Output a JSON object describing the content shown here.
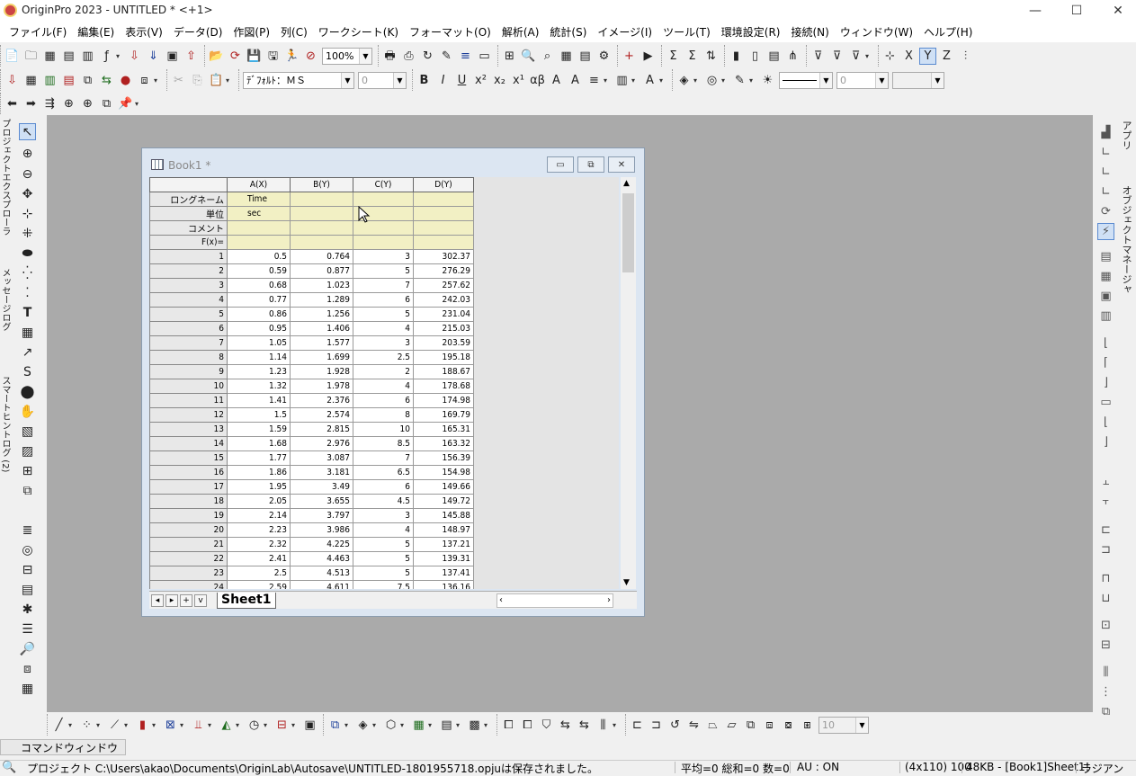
{
  "app": {
    "title": "OriginPro 2023 - UNTITLED * <+1>"
  },
  "window_controls": {
    "minimize": "—",
    "maximize": "☐",
    "close": "✕"
  },
  "menu": [
    "ファイル(F)",
    "編集(E)",
    "表示(V)",
    "データ(D)",
    "作図(P)",
    "列(C)",
    "ワークシート(K)",
    "フォーマット(O)",
    "解析(A)",
    "統計(S)",
    "イメージ(I)",
    "ツール(T)",
    "環境設定(R)",
    "接続(N)",
    "ウィンドウ(W)",
    "ヘルプ(H)"
  ],
  "toolbar": {
    "zoom_value": "100%",
    "font_name": "ﾃﾞﾌｫﾙﾄ：ＭＳ",
    "font_size": "0",
    "line_width": "0",
    "bottom_zoom": "10"
  },
  "left_tabs": [
    "プロジェクトエクスプローラ (3)",
    "メッセージログ",
    "スマートヒントログ (2)"
  ],
  "right_tabs": [
    "アプリ",
    "オブジェクトマネージャ"
  ],
  "book": {
    "title": "Book1 *",
    "columns": [
      "A(X)",
      "B(Y)",
      "C(Y)",
      "D(Y)"
    ],
    "label_rows": [
      {
        "name": "ロングネーム",
        "cells": [
          "Time",
          "",
          "",
          ""
        ]
      },
      {
        "name": "単位",
        "cells": [
          "sec",
          "",
          "",
          ""
        ]
      },
      {
        "name": "コメント",
        "cells": [
          "",
          "",
          "",
          ""
        ]
      },
      {
        "name": "F(x)=",
        "cells": [
          "",
          "",
          "",
          ""
        ]
      }
    ],
    "rows": [
      [
        "1",
        "0.5",
        "0.764",
        "3",
        "302.37"
      ],
      [
        "2",
        "0.59",
        "0.877",
        "5",
        "276.29"
      ],
      [
        "3",
        "0.68",
        "1.023",
        "7",
        "257.62"
      ],
      [
        "4",
        "0.77",
        "1.289",
        "6",
        "242.03"
      ],
      [
        "5",
        "0.86",
        "1.256",
        "5",
        "231.04"
      ],
      [
        "6",
        "0.95",
        "1.406",
        "4",
        "215.03"
      ],
      [
        "7",
        "1.05",
        "1.577",
        "3",
        "203.59"
      ],
      [
        "8",
        "1.14",
        "1.699",
        "2.5",
        "195.18"
      ],
      [
        "9",
        "1.23",
        "1.928",
        "2",
        "188.67"
      ],
      [
        "10",
        "1.32",
        "1.978",
        "4",
        "178.68"
      ],
      [
        "11",
        "1.41",
        "2.376",
        "6",
        "174.98"
      ],
      [
        "12",
        "1.5",
        "2.574",
        "8",
        "169.79"
      ],
      [
        "13",
        "1.59",
        "2.815",
        "10",
        "165.31"
      ],
      [
        "14",
        "1.68",
        "2.976",
        "8.5",
        "163.32"
      ],
      [
        "15",
        "1.77",
        "3.087",
        "7",
        "156.39"
      ],
      [
        "16",
        "1.86",
        "3.181",
        "6.5",
        "154.98"
      ],
      [
        "17",
        "1.95",
        "3.49",
        "6",
        "149.66"
      ],
      [
        "18",
        "2.05",
        "3.655",
        "4.5",
        "149.72"
      ],
      [
        "19",
        "2.14",
        "3.797",
        "3",
        "145.88"
      ],
      [
        "20",
        "2.23",
        "3.986",
        "4",
        "148.97"
      ],
      [
        "21",
        "2.32",
        "4.225",
        "5",
        "137.21"
      ],
      [
        "22",
        "2.41",
        "4.463",
        "5",
        "139.31"
      ],
      [
        "23",
        "2.5",
        "4.513",
        "5",
        "137.41"
      ],
      [
        "24",
        "2.59",
        "4.611",
        "7.5",
        "136.16"
      ]
    ],
    "sheet_nav": [
      "◂",
      "▸",
      "+",
      "v"
    ],
    "sheet_tab": "Sheet1"
  },
  "command_window": "コマンドウィンドウ",
  "status": {
    "message": "プロジェクト C:\\Users\\akao\\Documents\\OriginLab\\Autosave\\UNTITLED-1801955718.opjuは保存されました。",
    "stats": "平均=0 総和=0 数=0",
    "au": "AU : ON",
    "dims": "(4x110) 100",
    "size": "48KB - [Book1]Sheet1!",
    "angle": "ラジアン"
  }
}
